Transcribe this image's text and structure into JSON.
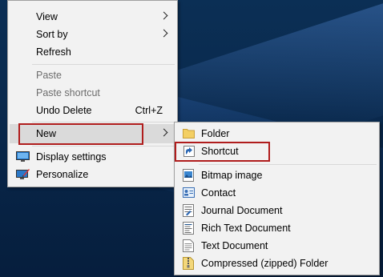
{
  "context_menu": {
    "items": {
      "view": {
        "label": "View"
      },
      "sort_by": {
        "label": "Sort by"
      },
      "refresh": {
        "label": "Refresh"
      },
      "paste": {
        "label": "Paste"
      },
      "paste_shortcut": {
        "label": "Paste shortcut"
      },
      "undo_delete": {
        "label": "Undo Delete",
        "accelerator": "Ctrl+Z"
      },
      "new": {
        "label": "New"
      },
      "display_settings": {
        "label": "Display settings"
      },
      "personalize": {
        "label": "Personalize"
      }
    }
  },
  "new_submenu": {
    "items": {
      "folder": {
        "label": "Folder"
      },
      "shortcut": {
        "label": "Shortcut"
      },
      "bitmap_image": {
        "label": "Bitmap image"
      },
      "contact": {
        "label": "Contact"
      },
      "journal_document": {
        "label": "Journal Document"
      },
      "rich_text_document": {
        "label": "Rich Text Document"
      },
      "text_document": {
        "label": "Text Document"
      },
      "compressed_folder": {
        "label": "Compressed (zipped) Folder"
      }
    }
  },
  "colors": {
    "highlight_border": "#b01d1d",
    "menu_background": "#f2f2f2",
    "desktop_background": "#0a2a4e"
  }
}
